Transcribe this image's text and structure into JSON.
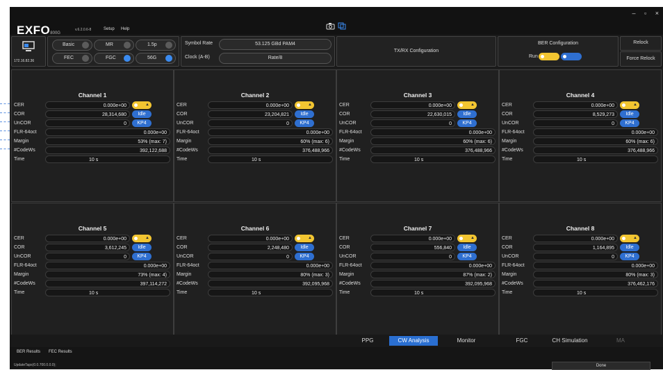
{
  "app": {
    "logo": "EXFO",
    "logo_sub": "800G",
    "version": "v.6.2.0.6-8",
    "menu": [
      "Setup",
      "Help"
    ]
  },
  "window": {
    "minimize": "–",
    "maximize": "▫",
    "close": "×"
  },
  "device": {
    "ip": "172.16.82.36"
  },
  "modes": {
    "basic": "Basic",
    "mr": "MR",
    "p15": "1.5p",
    "fec": "FEC",
    "fgc": "FGC",
    "g56": "56G"
  },
  "symbol": {
    "rate_label": "Symbol Rate",
    "rate_value": "53.125 GBd PAM4",
    "clock_label": "Clock (A-B)",
    "clock_value": "Rate/8"
  },
  "txrx": {
    "label": "TX/RX Configuration"
  },
  "ber": {
    "label": "BER Configuration",
    "run": "Run"
  },
  "actions": {
    "relock": "Relock",
    "force_relock": "Force Relock"
  },
  "labels": {
    "cer": "CER",
    "cor": "COR",
    "uncor": "UnCOR",
    "flr": "FLR-64oct",
    "margin": "Margin",
    "codews": "#CodeWs",
    "time": "Time"
  },
  "channels": [
    {
      "title": "Channel 1",
      "cer": "0.000e+00",
      "cor": "28,314,680",
      "cor_badge": "Idle",
      "uncor": "0",
      "uncor_badge": "KP4",
      "flr": "0.000e+00",
      "margin": "53% (max: 7)",
      "codews": "392,122,688",
      "time": "10 s"
    },
    {
      "title": "Channel 2",
      "cer": "0.000e+00",
      "cor": "23,204,821",
      "cor_badge": "Idle",
      "uncor": "0",
      "uncor_badge": "KP4",
      "flr": "0.000e+00",
      "margin": "60% (max: 6)",
      "codews": "376,488,966",
      "time": "10 s"
    },
    {
      "title": "Channel 3",
      "cer": "0.000e+00",
      "cor": "22,630,015",
      "cor_badge": "Idle",
      "uncor": "0",
      "uncor_badge": "KP4",
      "flr": "0.000e+00",
      "margin": "60% (max: 6)",
      "codews": "376,488,966",
      "time": "10 s"
    },
    {
      "title": "Channel 4",
      "cer": "0.000e+00",
      "cor": "8,529,273",
      "cor_badge": "Idle",
      "uncor": "0",
      "uncor_badge": "KP4",
      "flr": "0.000e+00",
      "margin": "60% (max: 6)",
      "codews": "376,488,966",
      "time": "10 s"
    },
    {
      "title": "Channel 5",
      "cer": "0.000e+00",
      "cor": "3,612,245",
      "cor_badge": "Idle",
      "uncor": "0",
      "uncor_badge": "KP4",
      "flr": "0.000e+00",
      "margin": "73% (max: 4)",
      "codews": "397,114,272",
      "time": "10 s"
    },
    {
      "title": "Channel 6",
      "cer": "0.000e+00",
      "cor": "2,248,480",
      "cor_badge": "Idle",
      "uncor": "0",
      "uncor_badge": "KP4",
      "flr": "0.000e+00",
      "margin": "80% (max: 3)",
      "codews": "392,095,968",
      "time": "10 s"
    },
    {
      "title": "Channel 7",
      "cer": "0.000e+00",
      "cor": "556,840",
      "cor_badge": "Idle",
      "uncor": "0",
      "uncor_badge": "KP4",
      "flr": "0.000e+00",
      "margin": "87% (max: 2)",
      "codews": "392,095,968",
      "time": "10 s"
    },
    {
      "title": "Channel 8",
      "cer": "0.000e+00",
      "cor": "1,164,895",
      "cor_badge": "Idle",
      "uncor": "0",
      "uncor_badge": "KP4",
      "flr": "0.000e+00",
      "margin": "80% (max: 3)",
      "codews": "376,462,176",
      "time": "10 s"
    }
  ],
  "tabs": [
    "PPG",
    "CW Analysis",
    "Monitor",
    "FGC",
    "CH Simulation",
    "MA"
  ],
  "active_tab": "CW Analysis",
  "bottom": {
    "ber_results": "BER Results",
    "fec_results": "FEC Results",
    "status": "UpdateTaps(0.0.700.0.0.0);",
    "done": "Done"
  },
  "colors": {
    "accent": "#2a6fd1",
    "toggle_on": "#f2c531",
    "background": "#1d1d1d"
  }
}
